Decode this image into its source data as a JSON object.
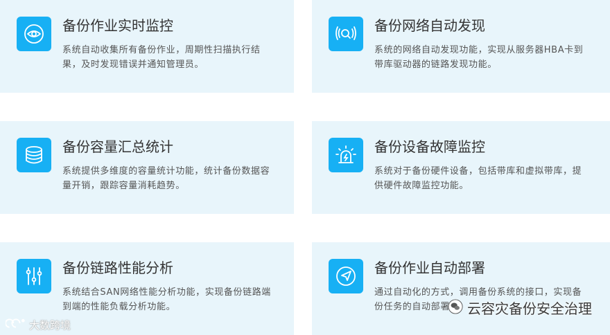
{
  "colors": {
    "card_bg": "#e8f5fb",
    "icon_bg": "#17b0f4",
    "title": "#333333",
    "text": "#555555"
  },
  "cards": [
    {
      "icon": "eye-icon",
      "title": "备份作业实时监控",
      "desc": "系统自动收集所有备份作业，周期性扫描执行结果，及时发现错误并通知管理员。"
    },
    {
      "icon": "radar-search-icon",
      "title": "备份网络自动发现",
      "desc": "系统的网络自动发现功能，实现从服务器HBA卡到带库驱动器的链路发现功能。"
    },
    {
      "icon": "database-icon",
      "title": "备份容量汇总统计",
      "desc": "系统提供多维度的容量统计功能，统计备份数据容量开销，跟踪容量消耗趋势。"
    },
    {
      "icon": "alarm-light-icon",
      "title": "备份设备故障监控",
      "desc": "系统对于备份硬件设备，包括带库和虚拟带库，提供硬件故障监控功能。"
    },
    {
      "icon": "sliders-icon",
      "title": "备份链路性能分析",
      "desc": "系统结合SAN网络性能分析功能，实现备份链路端到端的性能负载分析功能。"
    },
    {
      "icon": "send-arrow-icon",
      "title": "备份作业自动部署",
      "desc": "通过自动化的方式，调用备份系统的接口，实现备份任务的自动部署。"
    }
  ],
  "watermarks": {
    "right": "云容灾备份安全治理",
    "left": "大数跨境"
  }
}
